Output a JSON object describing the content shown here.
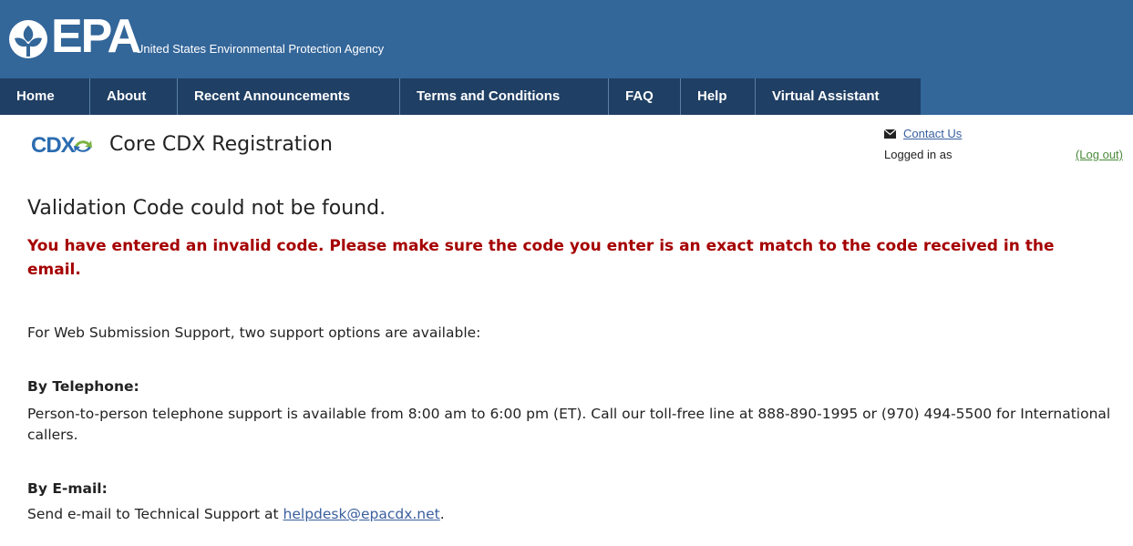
{
  "header": {
    "logo_text": "EPA",
    "agency_name": "United States Environmental Protection Agency",
    "banner_color": "#336699",
    "nav_color": "#1f3f64"
  },
  "nav": {
    "items": [
      {
        "label": "Home"
      },
      {
        "label": "About"
      },
      {
        "label": "Recent Announcements"
      },
      {
        "label": "Terms and Conditions"
      },
      {
        "label": "FAQ"
      },
      {
        "label": "Help"
      },
      {
        "label": "Virtual Assistant"
      }
    ]
  },
  "app": {
    "logo_text": "CDX",
    "title": "Core CDX Registration"
  },
  "user_panel": {
    "contact_label": "Contact Us",
    "logged_in_label": "Logged in as",
    "logout_label": "(Log out)"
  },
  "main": {
    "heading": "Validation Code could not be found.",
    "error_message": "You have entered an invalid code. Please make sure the code you enter is an exact match to the code received in the email.",
    "support_intro": "For Web Submission Support, two support options are available:",
    "telephone_heading": "By Telephone",
    "telephone_text": "Person-to-person telephone support is available from 8:00 am to 6:00 pm (ET). Call our toll-free line at 888-890-1995 or (970) 494-5500 for International callers.",
    "email_heading": "By E-mail",
    "email_text_prefix": "Send e-mail to Technical Support at ",
    "email_address": "helpdesk@epacdx.net",
    "email_text_suffix": ".",
    "error_color": "#a50000"
  }
}
